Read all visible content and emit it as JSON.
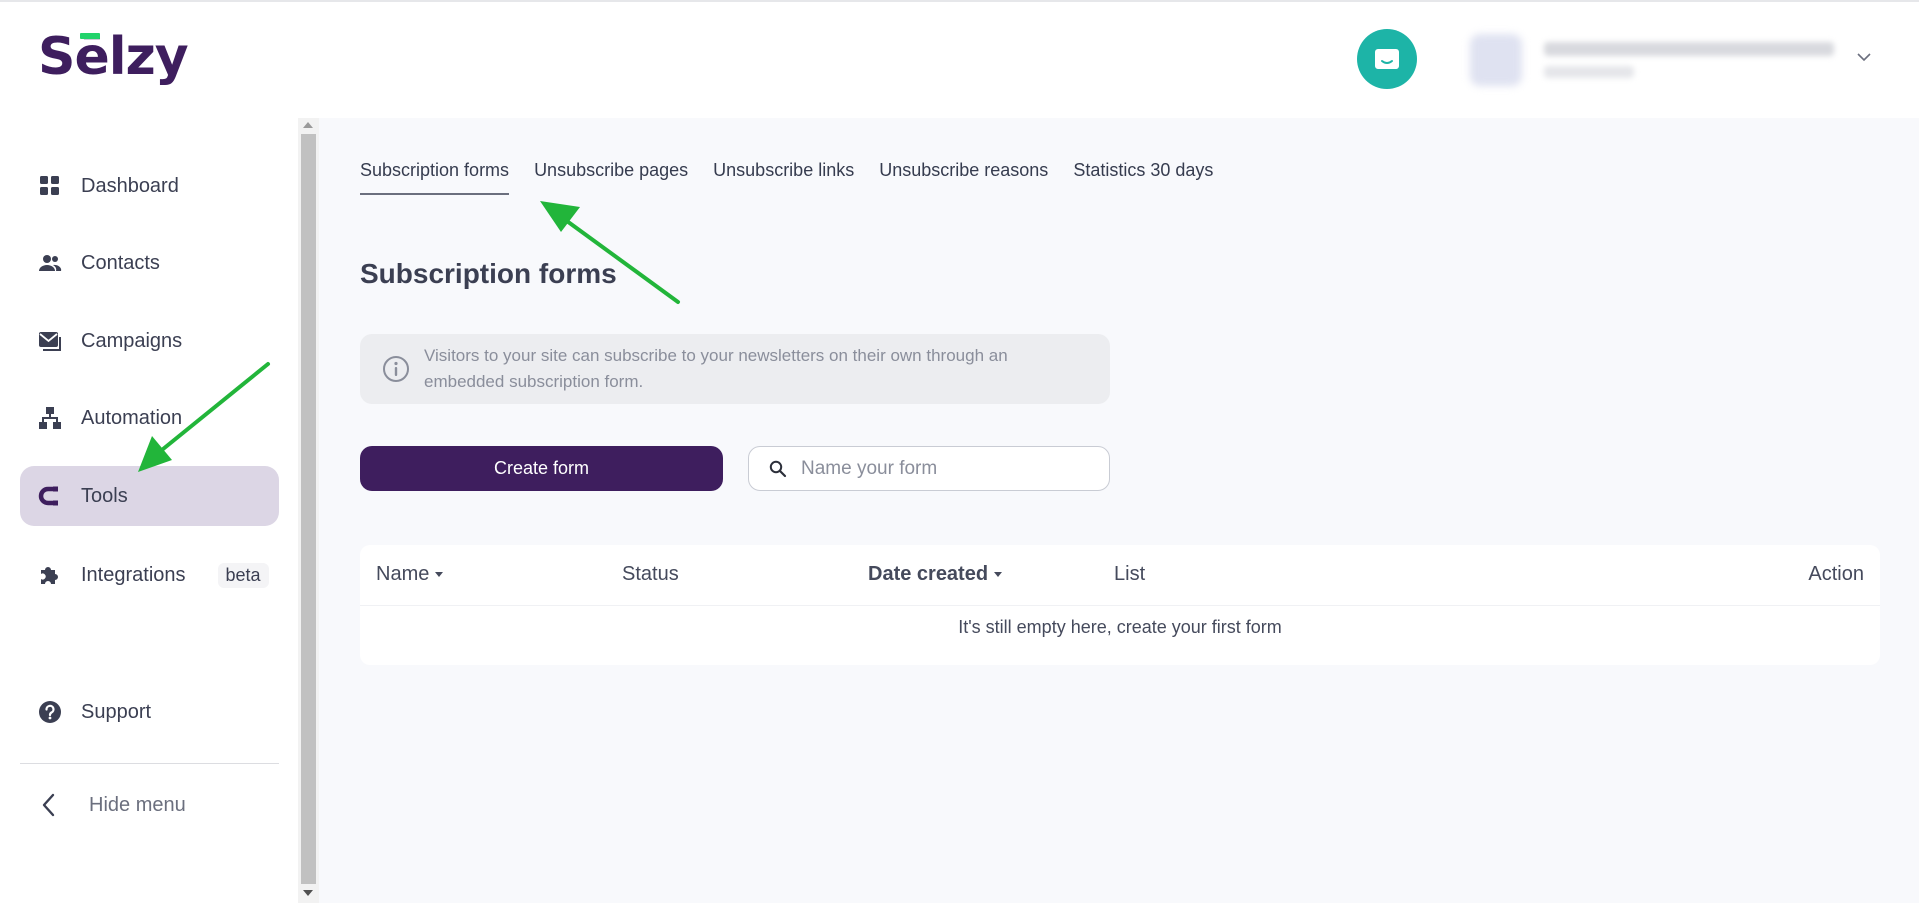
{
  "header": {
    "logo_text": "Sēlzy",
    "chat_icon": "chat-bubble-icon",
    "user": {
      "email": "",
      "subtitle": ""
    }
  },
  "sidebar": {
    "items": [
      {
        "label": "Dashboard",
        "icon": "dashboard-grid-icon",
        "active": false
      },
      {
        "label": "Contacts",
        "icon": "contacts-people-icon",
        "active": false
      },
      {
        "label": "Campaigns",
        "icon": "campaigns-envelope-icon",
        "active": false
      },
      {
        "label": "Automation",
        "icon": "automation-hierarchy-icon",
        "active": false
      },
      {
        "label": "Tools",
        "icon": "tools-magnet-icon",
        "active": true
      },
      {
        "label": "Integrations",
        "icon": "integrations-puzzle-icon",
        "active": false,
        "badge": "beta"
      },
      {
        "label": "Support",
        "icon": "support-question-icon",
        "active": false
      },
      {
        "label": "Hide menu",
        "icon": "chevron-left-icon",
        "active": false
      }
    ]
  },
  "tabs": [
    {
      "label": "Subscription forms",
      "active": true
    },
    {
      "label": "Unsubscribe pages",
      "active": false
    },
    {
      "label": "Unsubscribe links",
      "active": false
    },
    {
      "label": "Unsubscribe reasons",
      "active": false
    },
    {
      "label": "Statistics 30 days",
      "active": false
    }
  ],
  "main": {
    "title": "Subscription forms",
    "info_text": "Visitors to your site can subscribe to your newsletters on their own through an embedded subscription form.",
    "create_button": "Create form",
    "search_placeholder": "Name your form",
    "table": {
      "columns": [
        "Name",
        "Status",
        "Date created",
        "List",
        "Action"
      ],
      "empty_message": "It's still empty here, create your first form"
    }
  },
  "colors": {
    "brand": "#3e1e5e",
    "logo_accent": "#22d36b",
    "chat": "#1db4a7",
    "active_nav": "#dcd6e5",
    "annotation_arrow": "#22b53a"
  }
}
